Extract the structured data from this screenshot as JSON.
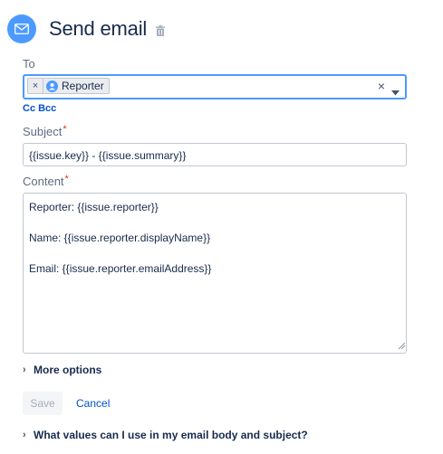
{
  "header": {
    "title": "Send email",
    "icon": "email-icon",
    "icon_color": "#4c9aff",
    "delete_icon": "trash-icon"
  },
  "to": {
    "label": "To",
    "chips": [
      {
        "label": "Reporter",
        "icon": "user-avatar-icon",
        "remove_symbol": "×"
      }
    ],
    "clear_symbol": "×",
    "focus_color": "#4c9aff"
  },
  "cc_bcc": {
    "label": "Cc Bcc"
  },
  "subject": {
    "label": "Subject",
    "required_mark": "*",
    "value": "{{issue.key}} - {{issue.summary}}"
  },
  "content": {
    "label": "Content",
    "required_mark": "*",
    "lines": [
      "Reporter: {{issue.reporter}}",
      "",
      "Name: {{issue.reporter.displayName}}",
      "",
      "Email: {{issue.reporter.emailAddress}}"
    ]
  },
  "more_options": {
    "label": "More options",
    "chevron": "›"
  },
  "actions": {
    "save_label": "Save",
    "cancel_label": "Cancel",
    "link_color": "#0052cc"
  },
  "help": {
    "label": "What values can I use in my email body and subject?",
    "chevron": "›"
  }
}
